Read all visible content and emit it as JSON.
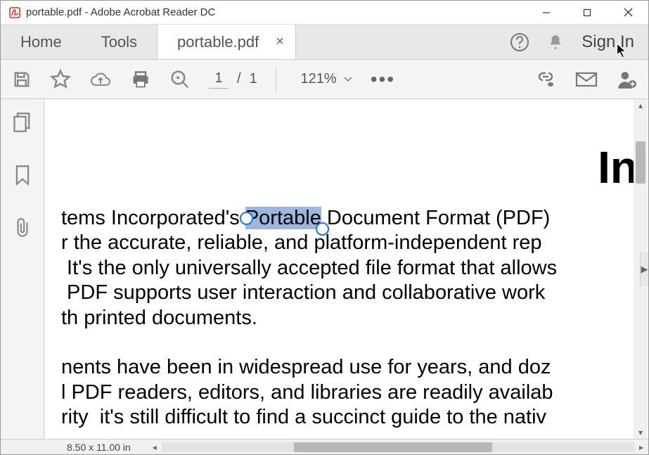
{
  "title": "portable.pdf - Adobe Acrobat Reader DC",
  "tabs": {
    "home": "Home",
    "tools": "Tools",
    "doc": "portable.pdf"
  },
  "topright": {
    "signin": "Sign In"
  },
  "toolbar": {
    "page_current": "1",
    "page_sep": "/",
    "page_total": "1",
    "zoom": "121%"
  },
  "document": {
    "heading_fragment": "In",
    "p1_l1_pre": "tems Incorporated's ",
    "p1_l1_sel": "Portable",
    "p1_l1_post": " Document Format (PDF)",
    "p1_l2": "r the accurate, reliable, and platform-independent rep",
    "p1_l3": " It's the only universally accepted file format that allows",
    "p1_l4": " PDF supports user interaction and collaborative work",
    "p1_l5": "th printed documents.",
    "p2_l1": "nents have been in widespread use for years, and doz",
    "p2_l2": "l PDF readers, editors, and libraries are readily availab",
    "p2_l3": "rity  it's still difficult to find a succinct guide to the nativ"
  },
  "status": {
    "size": "8.50 x 11.00 in"
  }
}
